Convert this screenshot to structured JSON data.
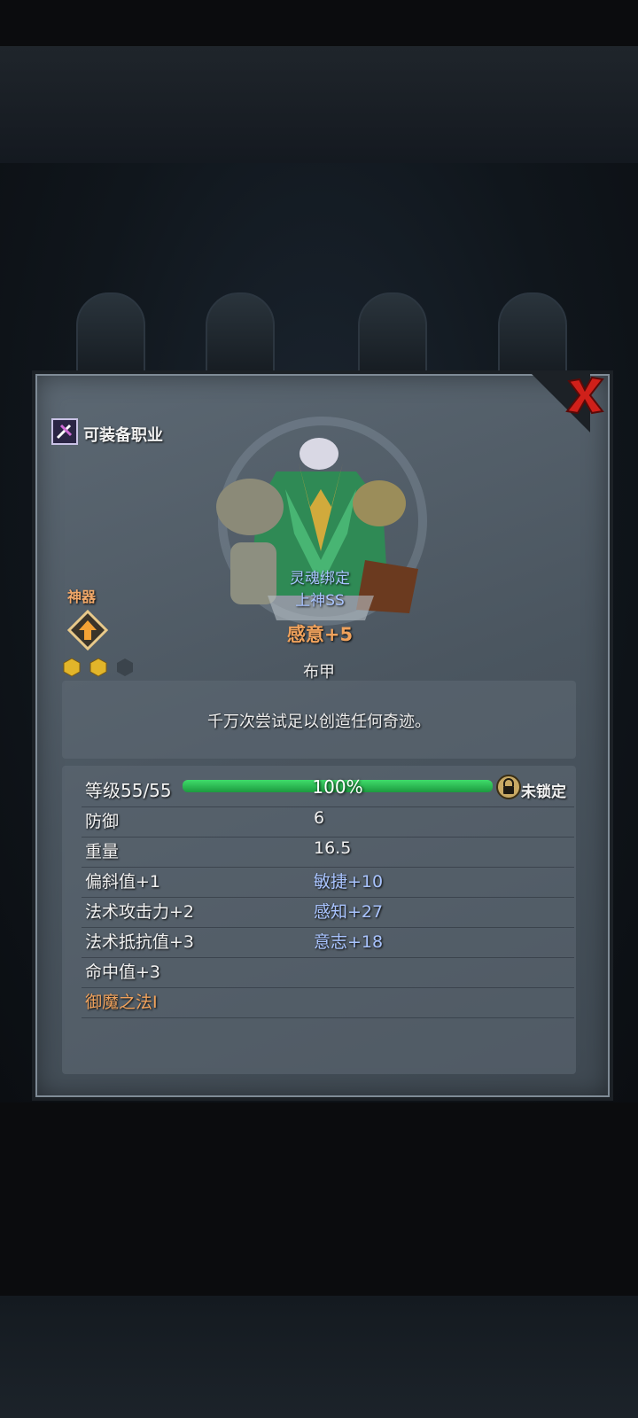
{
  "equip_class_label": "可装备职业",
  "item": {
    "soul_bound": "灵魂绑定",
    "grade": "上神SS",
    "enchant": "感意+5",
    "type": "布甲",
    "description": "千万次尝试足以创造任何奇迹。"
  },
  "artifact": {
    "label": "神器",
    "gems_filled": 2,
    "gems_total": 3
  },
  "level": {
    "label": "等级55/55",
    "progress_text": "100%",
    "progress": 1.0,
    "lock_label": "未锁定"
  },
  "stats": {
    "defense": "防御",
    "defense_value": "6",
    "weight": "重量",
    "weight_value": "16.5",
    "left": [
      "偏斜值+1",
      "法术攻击力+2",
      "法术抵抗值+3",
      "命中值+3"
    ],
    "right": [
      "敏捷+10",
      "感知+27",
      "意志+18"
    ],
    "special": "御魔之法I"
  },
  "colors": {
    "accent_orange": "#f0a25c",
    "accent_blue": "#a9c4ff",
    "progress_green": "#2fbd55",
    "close_red": "#d0201a"
  },
  "icons": {
    "close": "close-x-icon",
    "class": "class-icon",
    "artifact": "artifact-upgrade-icon",
    "lock": "padlock-icon",
    "gem": "gem-icon"
  }
}
